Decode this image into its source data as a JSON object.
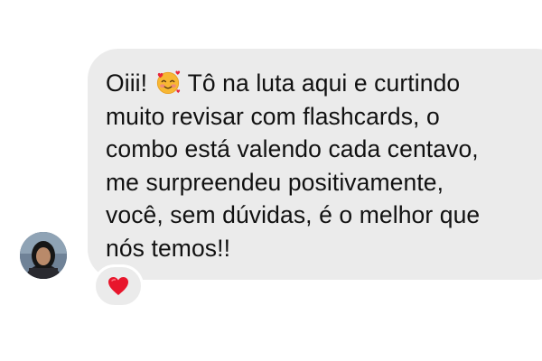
{
  "message": {
    "line_1": "Oiii!",
    "line_1_rest": " Tô na luta aqui e curtindo",
    "line_2": "muito revisar com flashcards, o",
    "line_3": "combo está valendo cada centavo,",
    "line_4": "me surpreendeu positivamente,",
    "line_5": "você, sem dúvidas, é o melhor que",
    "line_6": "nós temos!!",
    "emoji": "smiling-face-with-hearts-icon"
  },
  "reaction": {
    "icon": "red-heart-icon",
    "color": "#e8162c"
  },
  "colors": {
    "bubble": "#ebebeb",
    "text": "#111111",
    "background": "#ffffff"
  }
}
